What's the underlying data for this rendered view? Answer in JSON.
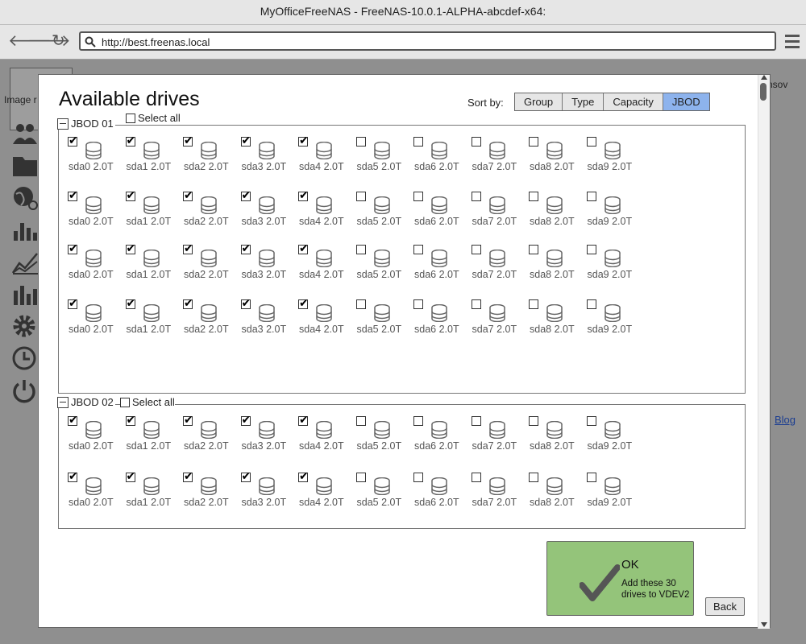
{
  "window": {
    "title": "MyOfficeFreeNAS - FreeNAS-10.0.1-ALPHA-abcdef-x64:"
  },
  "browser": {
    "url": "http://best.freenas.local"
  },
  "background": {
    "image_placeholder": "Image r",
    "user_fragment": "nsov",
    "blog_link": "Blog"
  },
  "dialog": {
    "title": "Available drives",
    "sort_label": "Sort by:",
    "sort_options": [
      "Group",
      "Type",
      "Capacity",
      "JBOD"
    ],
    "sort_active": "JBOD",
    "groups": [
      {
        "name": "JBOD 01",
        "select_all": "Select all",
        "rows": [
          [
            "sda0 2.0T",
            "sda1 2.0T",
            "sda2 2.0T",
            "sda3 2.0T",
            "sda4 2.0T",
            "sda5 2.0T",
            "sda6 2.0T",
            "sda7 2.0T",
            "sda8 2.0T",
            "sda9 2.0T"
          ],
          [
            "sda0 2.0T",
            "sda1 2.0T",
            "sda2 2.0T",
            "sda3 2.0T",
            "sda4 2.0T",
            "sda5 2.0T",
            "sda6 2.0T",
            "sda7 2.0T",
            "sda8 2.0T",
            "sda9 2.0T"
          ],
          [
            "sda0 2.0T",
            "sda1 2.0T",
            "sda2 2.0T",
            "sda3 2.0T",
            "sda4 2.0T",
            "sda5 2.0T",
            "sda6 2.0T",
            "sda7 2.0T",
            "sda8 2.0T",
            "sda9 2.0T"
          ],
          [
            "sda0 2.0T",
            "sda1 2.0T",
            "sda2 2.0T",
            "sda3 2.0T",
            "sda4 2.0T",
            "sda5 2.0T",
            "sda6 2.0T",
            "sda7 2.0T",
            "sda8 2.0T",
            "sda9 2.0T"
          ]
        ],
        "checked_count_per_row": 5
      },
      {
        "name": "JBOD 02",
        "select_all": "Select all",
        "rows": [
          [
            "sda0 2.0T",
            "sda1 2.0T",
            "sda2 2.0T",
            "sda3 2.0T",
            "sda4 2.0T",
            "sda5 2.0T",
            "sda6 2.0T",
            "sda7 2.0T",
            "sda8 2.0T",
            "sda9 2.0T"
          ],
          [
            "sda0 2.0T",
            "sda1 2.0T",
            "sda2 2.0T",
            "sda3 2.0T",
            "sda4 2.0T",
            "sda5 2.0T",
            "sda6 2.0T",
            "sda7 2.0T",
            "sda8 2.0T",
            "sda9 2.0T"
          ]
        ],
        "checked_count_per_row": 5
      }
    ],
    "ok_button": {
      "title": "OK",
      "description": "Add these 30 drives to VDEV2"
    },
    "back_button": "Back"
  },
  "colors": {
    "ok_green": "#94c47a",
    "active_sort": "#8db3ed"
  },
  "icons": {
    "drive": "database-icon",
    "ok": "checkmark-icon"
  }
}
